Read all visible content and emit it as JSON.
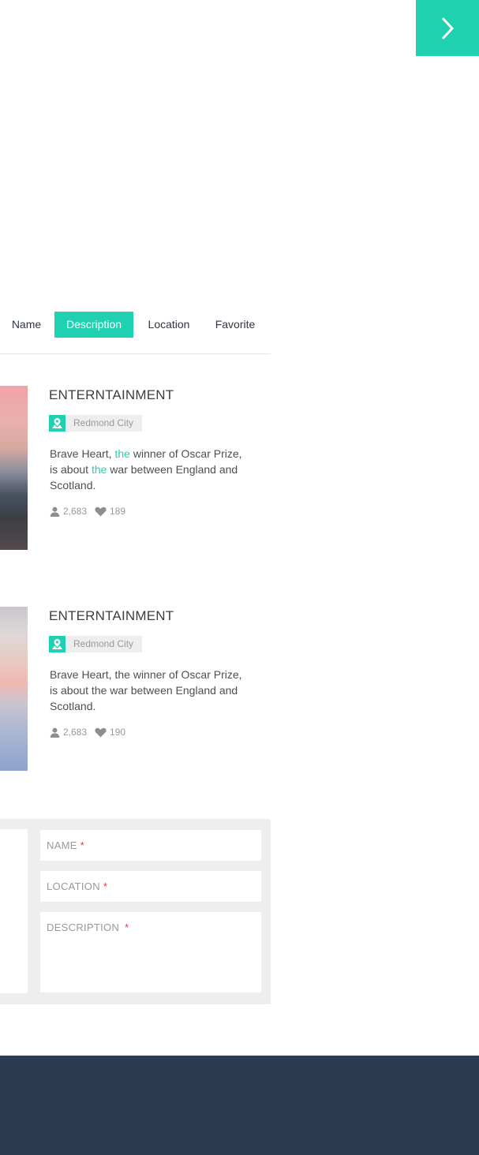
{
  "nav": {
    "next_icon": "chevron-right-icon",
    "accent": "#1fd1b0"
  },
  "tabs": [
    {
      "label": "Name",
      "active": false
    },
    {
      "label": "Description",
      "active": true
    },
    {
      "label": "Location",
      "active": false
    },
    {
      "label": "Favorite",
      "active": false
    }
  ],
  "cards": [
    {
      "title": "ENTERNTAINMENT",
      "location": "Redmond City",
      "desc_parts": [
        "Brave Heart, ",
        "the",
        " winner of Oscar Prize, is about ",
        "the",
        " war between England and Scotland."
      ],
      "views": "2,683",
      "likes": "189"
    },
    {
      "title": "ENTERNTAINMENT",
      "location": "Redmond City",
      "description": "Brave Heart, the winner of Oscar Prize, is about the war between England and Scotland.",
      "views": "2,683",
      "likes": "190"
    }
  ],
  "form": {
    "name_label": "NAME",
    "location_label": "LOCATION",
    "description_label": "DESCRIPTION",
    "required_mark": "*"
  },
  "colors": {
    "accent": "#1fd1b0",
    "footer": "#2c3c50",
    "required": "#e23b3b"
  }
}
